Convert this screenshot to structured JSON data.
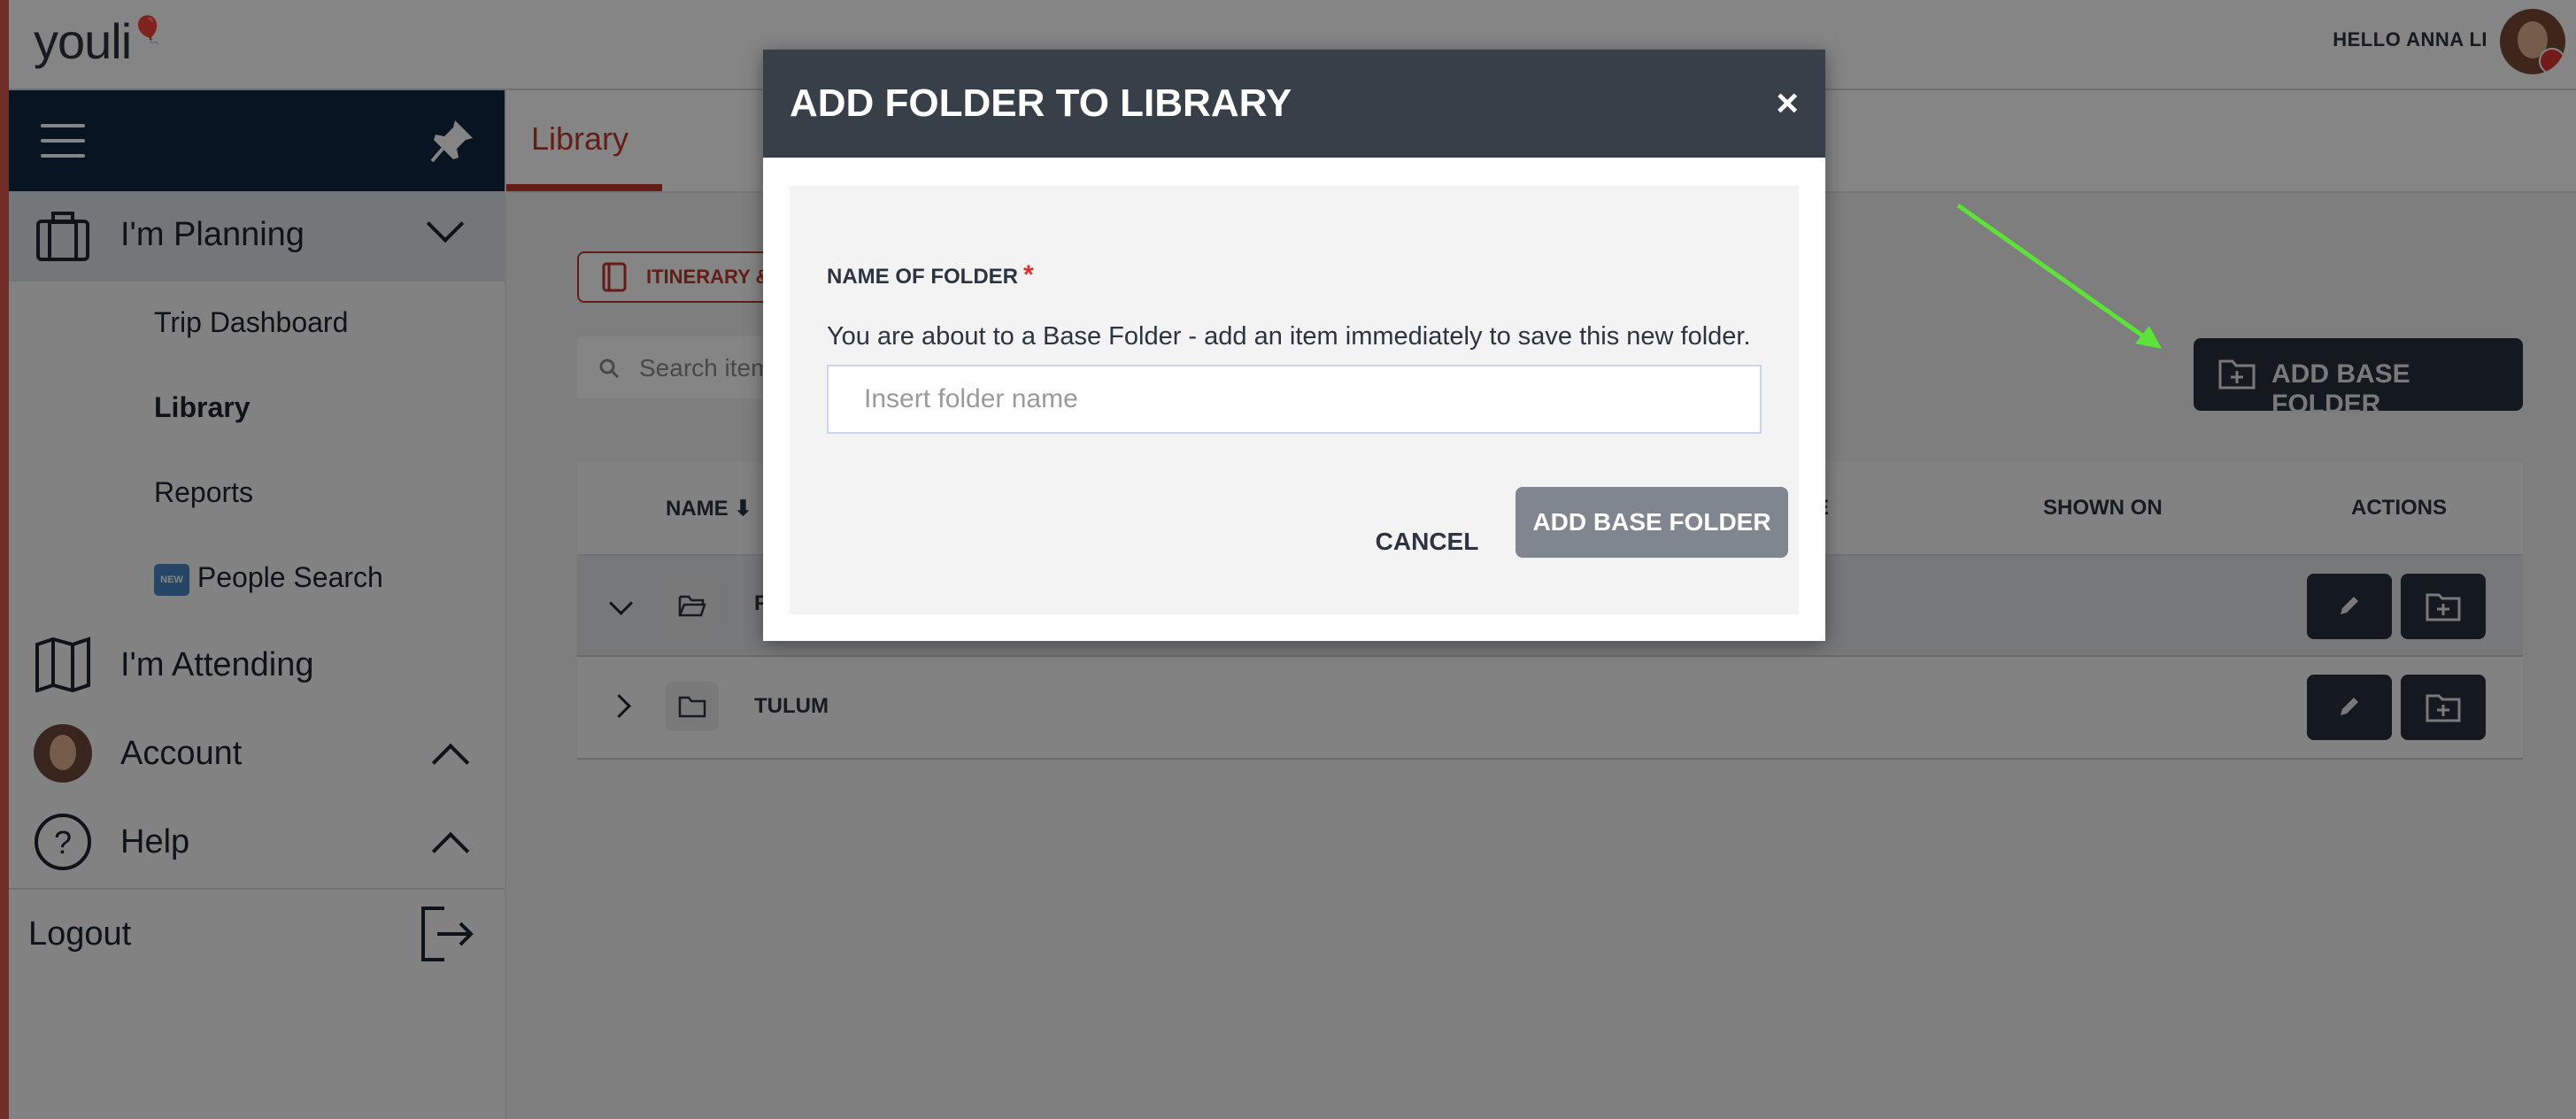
{
  "app": {
    "logo": "youli"
  },
  "header": {
    "greeting": "HELLO ANNA LI"
  },
  "sidebar": {
    "sections": [
      {
        "label": "I'm Planning"
      },
      {
        "label": "I'm Attending"
      },
      {
        "label": "Account"
      },
      {
        "label": "Help"
      }
    ],
    "sub_items": [
      {
        "label": "Trip Dashboard"
      },
      {
        "label": "Library"
      },
      {
        "label": "Reports"
      },
      {
        "label": "People Search",
        "badge": "NEW"
      }
    ],
    "logout": "Logout"
  },
  "main": {
    "tab": "Library",
    "filter_label": "ITINERARY &",
    "search_placeholder": "Search item",
    "add_base_folder": "ADD BASE FOLDER",
    "columns": [
      "NAME ⬇",
      "E",
      "SHOWN ON",
      "ACTIONS"
    ],
    "rows": [
      {
        "name": "F"
      },
      {
        "name": "TULUM"
      }
    ]
  },
  "modal": {
    "title": "ADD FOLDER TO LIBRARY",
    "close": "×",
    "field_label": "NAME OF FOLDER",
    "required_mark": "*",
    "help_text": "You are about to a Base Folder - add an item immediately to save this new folder.",
    "input_placeholder": "Insert folder name",
    "cancel": "CANCEL",
    "submit": "ADD BASE FOLDER"
  },
  "colors": {
    "accent": "#c0392b",
    "navy": "#0f2942",
    "dark": "#25303b",
    "arrow": "#5de23a"
  }
}
